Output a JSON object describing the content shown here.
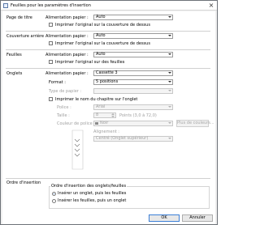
{
  "window": {
    "title": "Feuilles pour les paramètres d'insertion",
    "close_label": "×"
  },
  "cover_front": {
    "section_label": "Page de titre",
    "feed_label": "Alimentation papier :",
    "feed_value": "Auto",
    "print_label": "Imprimer l'original sur la couverture de dessus"
  },
  "cover_back": {
    "section_label": "Couverture arrière",
    "feed_label": "Alimentation papier :",
    "feed_value": "Auto",
    "print_label": "Imprimer l'original sur la couverture de dessus"
  },
  "sheets": {
    "section_label": "Feuilles",
    "feed_label": "Alimentation papier :",
    "feed_value": "Auto",
    "print_label": "Imprimer l'original sur des feuilles"
  },
  "tabs": {
    "section_label": "Onglets",
    "feed_label": "Alimentation papier :",
    "feed_value": "Cassette 3",
    "format_label": "Format :",
    "format_value": "5 positions",
    "paper_type_label": "Type de papier :",
    "paper_type_value": "",
    "print_chapter_label": "Imprimer le nom du chapitre sur l'onglet",
    "font_label": "Police :",
    "font_value": "Arial",
    "size_label": "Taille :",
    "size_value": "8",
    "size_hint": "Points (3,0 à 72,0)",
    "font_color_label": "Couleur de police :",
    "font_color_value": "Noir",
    "more_colors_label": "Plus de couleurs...",
    "alignment_label": "Alignement :",
    "alignment_value": "Centré (Onglet supérieur)"
  },
  "insert_order": {
    "section_label": "Ordre d'insertion",
    "group_title": "Ordre d'insertion des onglets/feuilles",
    "option1": "Insérer un onglet, puis les feuilles",
    "option2": "Insérer les feuilles, puis un onglet",
    "selected": 1
  },
  "footer": {
    "ok_label": "OK",
    "cancel_label": "Annuler"
  },
  "colors": {
    "accent": "#3c7fd6",
    "radio_dot": "#1a5fb4"
  }
}
